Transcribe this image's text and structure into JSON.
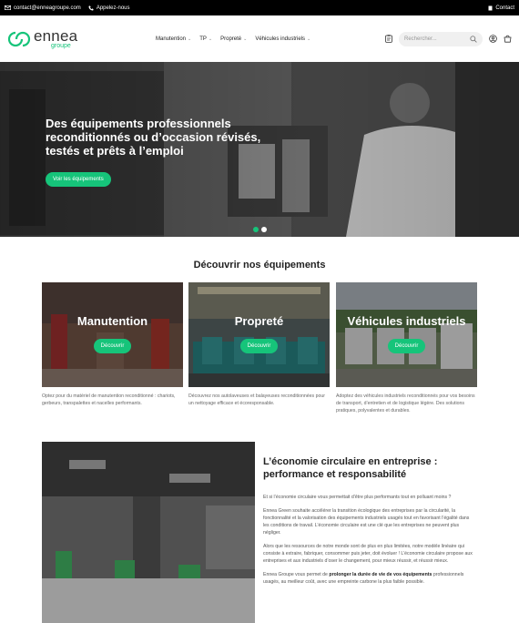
{
  "topbar": {
    "email": "contact@enneagroupe.com",
    "phone": "Appelez-nous",
    "contact": "Contact"
  },
  "header": {
    "logo_name": "ennea",
    "logo_sub": "groupe",
    "nav": [
      "Manutention",
      "TP",
      "Propreté",
      "Véhicules industriels"
    ],
    "search_placeholder": "Rechercher..."
  },
  "hero": {
    "headline": "Des équipements professionnels reconditionnés ou d’occasion révisés, testés et prêts à l’emploi",
    "cta": "Voir les équipements",
    "slides": 2,
    "active_slide": 1
  },
  "categories": {
    "title": "Découvrir nos équipements",
    "button_label": "Découvrir",
    "items": [
      {
        "title": "Manutention",
        "desc": "Optez pour du matériel de manutention reconditionné : chariots, gerbeurs, transpalettes et nacelles performants."
      },
      {
        "title": "Propreté",
        "desc": "Découvrez nos autolaveuses et balayeuses reconditionnées pour un nettoyage efficace et écoresponsable."
      },
      {
        "title": "Véhicules industriels",
        "desc": "Adoptez des véhicules industriels reconditionnés pour vos besoins de transport, d’entretien et de logistique légère. Des solutions pratiques, polyvalentes et durables."
      }
    ]
  },
  "economy": {
    "title": "L’économie circulaire en entreprise : performance et responsabilité",
    "p1": "Et si l’économie circulaire vous permettait d’être plus performants tout en polluant moins ?",
    "p2": "Ennea Green souhaite accélérer la transition écologique des entreprises par la circularité, la fonctionnalité et la valorisation des équipements industriels usagés tout en favorisant l’égalité dans les conditions de travail. L’économie circulaire est une clé que les entreprises ne peuvent plus négliger.",
    "p3": "Alors que les ressources de notre monde sont de plus en plus limitées, notre modèle linéaire qui consiste à extraire, fabriquer, consommer puis jeter, doit évoluer ! L’économie circulaire propose aux entreprises et aux industriels d’oser le changement, pour mieux réussir, et réussir mieux.",
    "p4_pre": "Ennea Groupe vous permet de",
    "p4_bold": "prolonger la durée de vie de vos équipements",
    "p4_post": "professionnels usagés, au meilleur coût, avec une empreinte carbone la plus faible possible."
  },
  "colors": {
    "accent": "#16c47a",
    "topbar": "#000000"
  }
}
